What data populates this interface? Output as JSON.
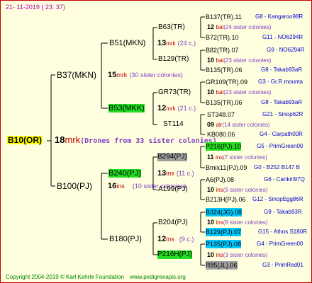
{
  "header": {
    "timestamp": "21-  11-2019  ( 23:  37)"
  },
  "footer": {
    "copyright": "Copyright 2004-2019 © Karl Kehrle Foundation",
    "site": "www.pedigreeapis.org"
  },
  "root": {
    "id": "B10(OR)",
    "num": "18",
    "label": "mrk",
    "note": "(Drones from 33 sister colonies)"
  },
  "gen1": [
    {
      "id": "B37(MKN)",
      "num": "15",
      "label": "mrk",
      "note": "(30 sister colonies)"
    },
    {
      "id": "B100(PJ)",
      "num": "16",
      "label": "ins",
      "note": "(10 sister colonies)"
    }
  ],
  "gen2": [
    {
      "id": "B51(MKN)",
      "num": "13",
      "label": "mrk",
      "note": "(24 c.)"
    },
    {
      "id": "B53(MKK)",
      "num": "12",
      "label": "mrk",
      "note": "(21 c.)"
    },
    {
      "id": "B240(PJ)",
      "num": "13",
      "label": "ins",
      "note": "(11 c.)"
    },
    {
      "id": "B180(PJ)",
      "num": "12",
      "label": "ins",
      "note": "(9 c.)"
    }
  ],
  "gen3": [
    {
      "id": "B63(TR)"
    },
    {
      "id": "B129(TR)"
    },
    {
      "id": "GR73(TR)"
    },
    {
      "id": "ST114"
    },
    {
      "id": "B294(PJ)"
    },
    {
      "id": "A199(PJ)"
    },
    {
      "id": "B204(PJ)"
    },
    {
      "id": "P216H(PJ)"
    }
  ],
  "gen4": [
    {
      "id": "B137(TR).11",
      "tag": "G8 - Kangaroo98R"
    },
    {
      "num": "12",
      "label": "bal",
      "note": "(24 sister colonies)"
    },
    {
      "id": "B72(TR).10",
      "tag": "G11 - NO6294R"
    },
    {
      "id": "B82(TR).07",
      "tag": "G9 - NO6294R"
    },
    {
      "num": "10",
      "label": "bal",
      "note": "(23 sister colonies)"
    },
    {
      "id": "B135(TR).06",
      "tag": "G8 - Takab93aR"
    },
    {
      "id": "GR109(TR).09",
      "tag": "G3 - Gr.R.mounta"
    },
    {
      "num": "10",
      "label": "bal",
      "note": "(23 sister colonies)"
    },
    {
      "id": "B135(TR).06",
      "tag": "G8 - Takab93aR"
    },
    {
      "id": "ST348.07",
      "tag": "G21 - Sinop62R"
    },
    {
      "num": "09",
      "label": "alr",
      "note": "(14 sister colonies)"
    },
    {
      "id": "KB080.06",
      "tag": "G4 - Carpath00R"
    },
    {
      "id": "P216(PJ).10",
      "tag": "G5 - PrimGreen00"
    },
    {
      "num": "11",
      "label": "ins",
      "note": "(7 sister colonies)"
    },
    {
      "id": "Bmix11(PJ).09",
      "tag": "G0 - B252 B147 B"
    },
    {
      "id": "A6(PJ).08",
      "tag": "G6 - Cankiri97Q"
    },
    {
      "num": "10",
      "label": "ins",
      "note": "(9 sister colonies)"
    },
    {
      "id": "B213H(PJ).06",
      "tag": "G12 - SinopEgg86R"
    },
    {
      "id": "B324(JG).08",
      "tag": "G9 - Takab93R"
    },
    {
      "num": "10",
      "label": "ins",
      "note": "(8 sister colonies)"
    },
    {
      "id": "B129(PJ).07",
      "tag": "G15 - Athos S180R"
    },
    {
      "id": "P135(PJ).08",
      "tag": "G4 - PrimGreen00"
    },
    {
      "num": "10",
      "label": "ins",
      "note": "(3 sister colonies)"
    },
    {
      "id": "R85(JL).06",
      "tag": "G3 - PrimRed01"
    }
  ],
  "colors": {
    "background": "#ffffe0",
    "header": "#b000b0",
    "mark_label": "#c00000",
    "note_purple": "#8040c0",
    "tag_blue": "#0000cc",
    "footer": "#008000",
    "highlight_blue": "#00c8ff",
    "highlight_green": "#22dd22",
    "highlight_grey": "#a0a0a0"
  }
}
